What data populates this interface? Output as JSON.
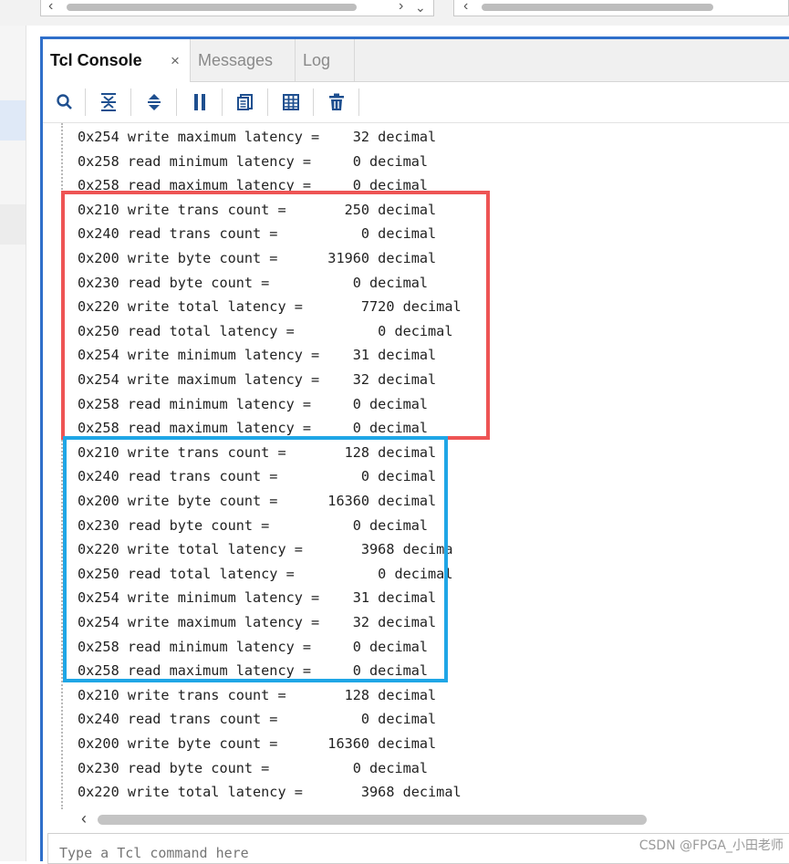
{
  "colors": {
    "panel_border": "#2f6fca",
    "red_box": "#ee5454",
    "blue_box": "#1fa6e6",
    "left_selected": "#dfe9f7"
  },
  "tabs": [
    {
      "label": "Tcl Console",
      "active": true,
      "close": "×"
    },
    {
      "label": "Messages",
      "active": false
    },
    {
      "label": "Log",
      "active": false
    }
  ],
  "toolbar": [
    {
      "icon": "search-icon"
    },
    {
      "icon": "collapse-all-icon"
    },
    {
      "icon": "expand-collapse-icon"
    },
    {
      "icon": "pause-icon"
    },
    {
      "icon": "copy-icon"
    },
    {
      "icon": "columns-icon"
    },
    {
      "icon": "trash-icon"
    }
  ],
  "console_lines": [
    "0x254 write maximum latency =    32 decimal",
    "0x258 read minimum latency =     0 decimal",
    "0x258 read maximum latency =     0 decimal",
    "0x210 write trans count =       250 decimal",
    "0x240 read trans count =          0 decimal",
    "0x200 write byte count =      31960 decimal",
    "0x230 read byte count =          0 decimal",
    "0x220 write total latency =       7720 decimal",
    "0x250 read total latency =          0 decimal",
    "0x254 write minimum latency =    31 decimal",
    "0x254 write maximum latency =    32 decimal",
    "0x258 read minimum latency =     0 decimal",
    "0x258 read maximum latency =     0 decimal",
    "0x210 write trans count =       128 decimal",
    "0x240 read trans count =          0 decimal",
    "0x200 write byte count =      16360 decimal",
    "0x230 read byte count =          0 decimal",
    "0x220 write total latency =       3968 decima",
    "0x250 read total latency =          0 decimal",
    "0x254 write minimum latency =    31 decimal",
    "0x254 write maximum latency =    32 decimal",
    "0x258 read minimum latency =     0 decimal",
    "0x258 read maximum latency =     0 decimal",
    "0x210 write trans count =       128 decimal",
    "0x240 read trans count =          0 decimal",
    "0x200 write byte count =      16360 decimal",
    "0x230 read byte count =          0 decimal",
    "0x220 write total latency =       3968 decimal",
    "0x250 read total latency =          0 decimal"
  ],
  "command_input": {
    "placeholder": "Type a Tcl command here",
    "value": ""
  },
  "watermark": "CSDN @FPGA_小田老师"
}
